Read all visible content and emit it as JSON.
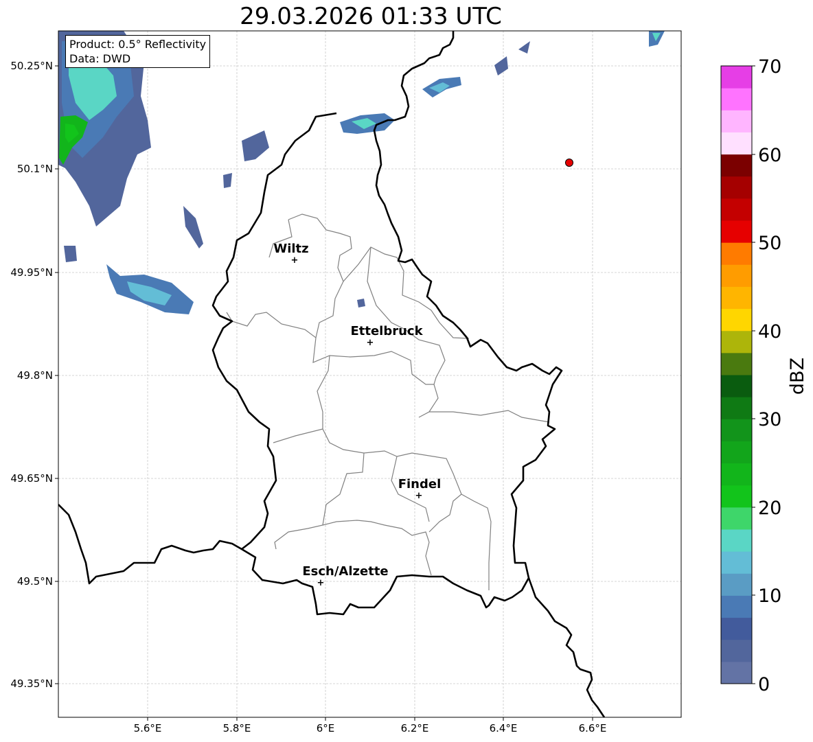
{
  "title": "29.03.2026 01:33 UTC",
  "info": {
    "product": "Product: 0.5° Reflectivity",
    "source": "Data: DWD"
  },
  "axes": {
    "lon_ticks": [
      "5.6°E",
      "5.8°E",
      "6°E",
      "6.2°E",
      "6.4°E",
      "6.6°E"
    ],
    "lat_ticks": [
      "50.25°N",
      "50.1°N",
      "49.95°N",
      "49.8°N",
      "49.65°N",
      "49.5°N",
      "49.35°N"
    ],
    "lon_values": [
      5.6,
      5.8,
      6.0,
      6.2,
      6.4,
      6.6
    ],
    "lat_values": [
      50.25,
      50.1,
      49.95,
      49.8,
      49.65,
      49.5,
      49.35
    ],
    "lon_range": [
      5.4,
      6.8
    ],
    "lat_range": [
      49.3,
      50.3
    ]
  },
  "colorbar": {
    "label": "dBZ",
    "ticks": [
      "0",
      "10",
      "20",
      "30",
      "40",
      "50",
      "60",
      "70"
    ],
    "range": [
      0,
      70
    ],
    "step": 2.5,
    "colors": [
      "#6373a5",
      "#52669c",
      "#425b9c",
      "#4a7ab5",
      "#5a9cc4",
      "#63bdd6",
      "#5ad6c5",
      "#3ed66a",
      "#12c41b",
      "#12b51b",
      "#12a51b",
      "#12941b",
      "#0f7a14",
      "#0a5c0f",
      "#4a7a0f",
      "#adb50a",
      "#ffd600",
      "#ffb500",
      "#ff9c00",
      "#ff7b00",
      "#e60000",
      "#c40000",
      "#a50000",
      "#7b0000",
      "#ffe0ff",
      "#ffb5ff",
      "#ff73ff",
      "#e63ee6"
    ]
  },
  "cities": [
    {
      "name": "Wiltz",
      "lon": 5.93,
      "lat": 49.966
    },
    {
      "name": "Ettelbruck",
      "lon": 6.1,
      "lat": 49.847
    },
    {
      "name": "Findel",
      "lon": 6.21,
      "lat": 49.627
    },
    {
      "name": "Esch/Alzette",
      "lon": 5.99,
      "lat": 49.5
    }
  ],
  "radar_site": {
    "lon": 6.548,
    "lat": 50.111,
    "color": "#e60000"
  }
}
